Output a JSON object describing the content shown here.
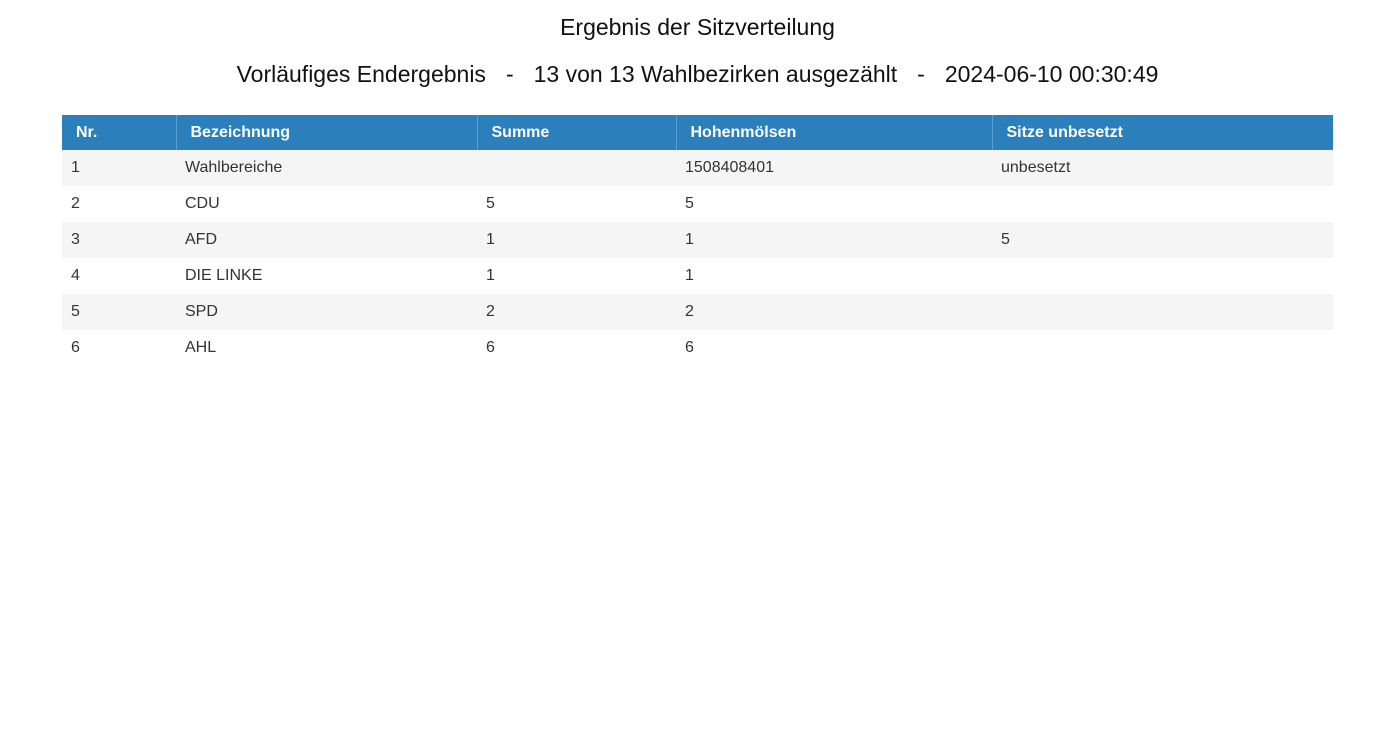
{
  "header": {
    "title": "Ergebnis der Sitzverteilung",
    "status": "Vorläufiges Endergebnis",
    "separator": "-",
    "counted": "13 von 13 Wahlbezirken ausgezählt",
    "timestamp": "2024-06-10 00:30:49"
  },
  "table": {
    "columns": [
      "Nr.",
      "Bezeichnung",
      "Summe",
      "Hohenmölsen",
      "Sitze unbesetzt"
    ],
    "rows": [
      [
        "1",
        "Wahlbereiche",
        "",
        "1508408401",
        "unbesetzt"
      ],
      [
        "2",
        "CDU",
        "5",
        "5",
        ""
      ],
      [
        "3",
        "AFD",
        "1",
        "1",
        "5"
      ],
      [
        "4",
        "DIE LINKE",
        "1",
        "1",
        ""
      ],
      [
        "5",
        "SPD",
        "2",
        "2",
        ""
      ],
      [
        "6",
        "AHL",
        "6",
        "6",
        ""
      ]
    ]
  }
}
